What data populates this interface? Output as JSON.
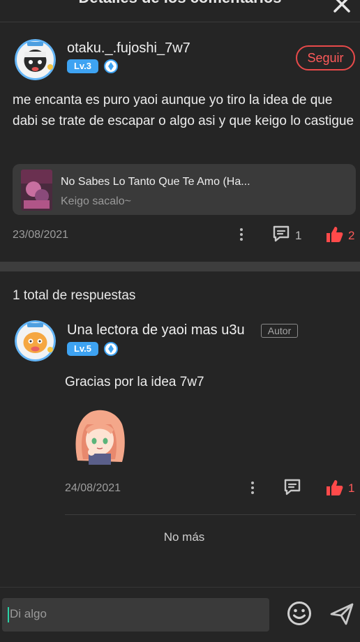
{
  "header": {
    "title": "Detalles de los comentarios",
    "close_icon": "close-icon"
  },
  "comment": {
    "username": "otaku._.fujoshi_7w7",
    "level": "Lv.3",
    "follow_label": "Seguir",
    "text": "me encanta es puro yaoi aunque yo tiro la idea  de que dabi se trate de escapar o algo asi y que keigo lo castigue",
    "story": {
      "title": "No Sabes Lo Tanto Que Te Amo (Ha...",
      "subtitle": "Keigo sacalo~"
    },
    "date": "23/08/2021",
    "reply_count": "1",
    "like_count": "2"
  },
  "replies": {
    "total_label": "1 total de respuestas",
    "items": [
      {
        "username": "Una lectora de yaoi mas u3u",
        "author_tag": "Autor",
        "level": "Lv.5",
        "text": "Gracias por la idea 7w7",
        "date": "24/08/2021",
        "like_count": "1"
      }
    ],
    "no_more_label": "No más"
  },
  "input": {
    "placeholder": "Di algo"
  },
  "colors": {
    "accent_red": "#ff4a4a",
    "level_blue": "#3ea3f2",
    "background": "#252525"
  }
}
